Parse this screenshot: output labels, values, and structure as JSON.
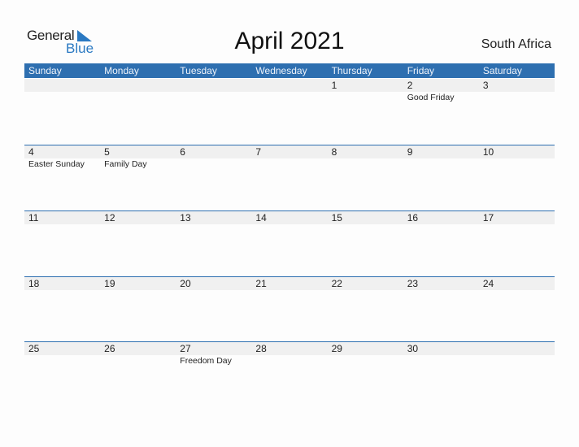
{
  "logo": {
    "line1": "General",
    "line2": "Blue",
    "accent": "#2a79c2"
  },
  "title": "April 2021",
  "country": "South Africa",
  "colors": {
    "header_bg": "#2e6fb0",
    "band_bg": "#f0f0f0"
  },
  "weekdays": [
    "Sunday",
    "Monday",
    "Tuesday",
    "Wednesday",
    "Thursday",
    "Friday",
    "Saturday"
  ],
  "weeks": [
    [
      {
        "day": "",
        "holiday": ""
      },
      {
        "day": "",
        "holiday": ""
      },
      {
        "day": "",
        "holiday": ""
      },
      {
        "day": "",
        "holiday": ""
      },
      {
        "day": "1",
        "holiday": ""
      },
      {
        "day": "2",
        "holiday": "Good Friday"
      },
      {
        "day": "3",
        "holiday": ""
      }
    ],
    [
      {
        "day": "4",
        "holiday": "Easter Sunday"
      },
      {
        "day": "5",
        "holiday": "Family Day"
      },
      {
        "day": "6",
        "holiday": ""
      },
      {
        "day": "7",
        "holiday": ""
      },
      {
        "day": "8",
        "holiday": ""
      },
      {
        "day": "9",
        "holiday": ""
      },
      {
        "day": "10",
        "holiday": ""
      }
    ],
    [
      {
        "day": "11",
        "holiday": ""
      },
      {
        "day": "12",
        "holiday": ""
      },
      {
        "day": "13",
        "holiday": ""
      },
      {
        "day": "14",
        "holiday": ""
      },
      {
        "day": "15",
        "holiday": ""
      },
      {
        "day": "16",
        "holiday": ""
      },
      {
        "day": "17",
        "holiday": ""
      }
    ],
    [
      {
        "day": "18",
        "holiday": ""
      },
      {
        "day": "19",
        "holiday": ""
      },
      {
        "day": "20",
        "holiday": ""
      },
      {
        "day": "21",
        "holiday": ""
      },
      {
        "day": "22",
        "holiday": ""
      },
      {
        "day": "23",
        "holiday": ""
      },
      {
        "day": "24",
        "holiday": ""
      }
    ],
    [
      {
        "day": "25",
        "holiday": ""
      },
      {
        "day": "26",
        "holiday": ""
      },
      {
        "day": "27",
        "holiday": "Freedom Day"
      },
      {
        "day": "28",
        "holiday": ""
      },
      {
        "day": "29",
        "holiday": ""
      },
      {
        "day": "30",
        "holiday": ""
      },
      {
        "day": "",
        "holiday": ""
      }
    ]
  ]
}
